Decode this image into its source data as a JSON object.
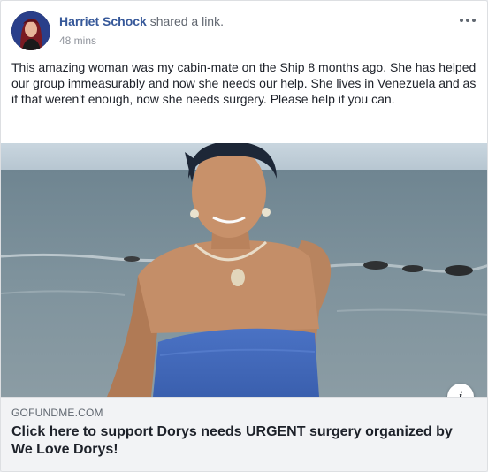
{
  "post": {
    "author": "Harriet Schock",
    "action": "shared a link.",
    "time": "48 mins",
    "text": "This amazing woman was my cabin-mate on the Ship 8 months ago. She has helped our group immeasurably and now she needs our help. She lives in Venezuela and as if that weren't enough, now she needs surgery. Please help if you can."
  },
  "link": {
    "domain": "GOFUNDME.COM",
    "title": "Click here to support Dorys needs URGENT surgery organized by We Love Dorys!"
  },
  "icons": {
    "more": "more-options-icon",
    "info": "info-icon"
  },
  "colors": {
    "author_link": "#365899",
    "text": "#1d2129",
    "muted": "#90949c",
    "link_box_bg": "#f2f3f5"
  }
}
